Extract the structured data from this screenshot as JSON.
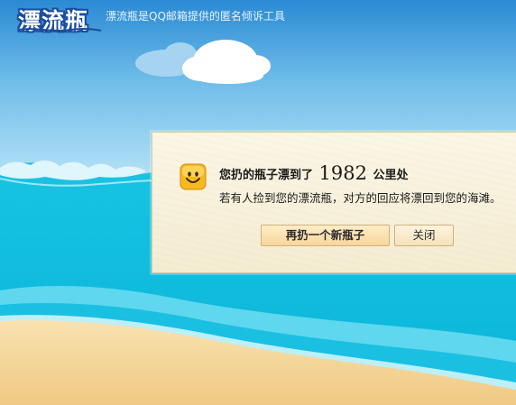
{
  "header": {
    "logo_text": "漂流瓶",
    "tagline": "漂流瓶是QQ邮箱提供的匿名倾诉工具"
  },
  "dialog": {
    "title_prefix": "您扔的瓶子漂到了",
    "distance": "1982",
    "title_suffix": "公里处",
    "message": "若有人捡到您的漂流瓶，对方的回应将漂回到您的海滩。",
    "smiley_icon": "smiley-face-icon",
    "primary_button": "再扔一个新瓶子",
    "secondary_button": "关闭"
  },
  "colors": {
    "sky_top": "#2a8ad4",
    "sky_bottom": "#a8dcf5",
    "sea": "#12c0e0",
    "sand": "#f5d8a0",
    "dialog_bg": "#fbf6e6"
  }
}
